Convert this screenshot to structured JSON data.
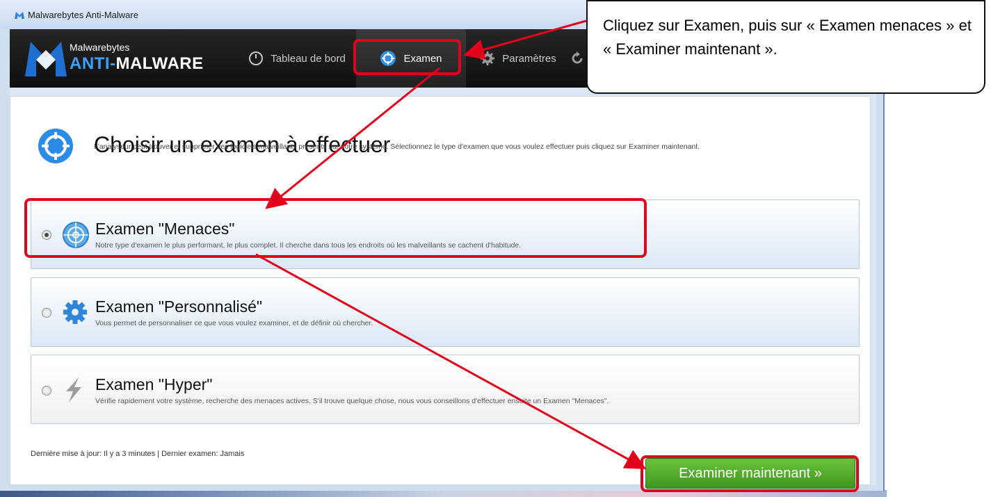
{
  "window": {
    "title": "Malwarebytes Anti-Malware"
  },
  "logo": {
    "small": "Malwarebytes",
    "big_prefix": "ANTI-",
    "big_suffix": "MALWARE"
  },
  "nav": {
    "dashboard": "Tableau de bord",
    "exam": "Examen",
    "settings": "Paramètres"
  },
  "panel": {
    "title": "Choisir un examen à effectuer",
    "description": "L'analyseur peut trouver et supprimer des logiciels malveillants présents sur votre système. Sélectionnez le type d'examen que vous voulez effectuer puis cliquez sur Examiner maintenant."
  },
  "options": [
    {
      "title": "Examen \"Menaces\"",
      "description": "Notre type d'examen le plus performant, le plus complet. Il cherche dans tous les endroits où les malveillants se cachent d'habitude.",
      "selected": true,
      "icon": "radar-globe-icon"
    },
    {
      "title": "Examen \"Personnalisé\"",
      "description": "Vous permet de personnaliser ce que vous voulez examiner, et de définir où chercher.",
      "selected": false,
      "icon": "gear-icon"
    },
    {
      "title": "Examen \"Hyper\"",
      "description": "Vérifie rapidement votre système, recherche des menaces actives. S'il trouve quelque chose, nous vous conseillons d'effectuer ensuite un Examen \"Menaces\".",
      "selected": false,
      "icon": "lightning-icon"
    }
  ],
  "status": "Dernière mise à jour: Il y a 3 minutes | Dernier examen: Jamais",
  "scan_button": "Examiner maintenant »",
  "callout": {
    "text": "Cliquez sur Examen, puis sur « Examen menaces » et « Examiner maintenant »."
  },
  "colors": {
    "accent": "#3aa0ff",
    "highlight": "#e3001b",
    "button": "#4fa82a",
    "header": "#1a1a1a"
  }
}
